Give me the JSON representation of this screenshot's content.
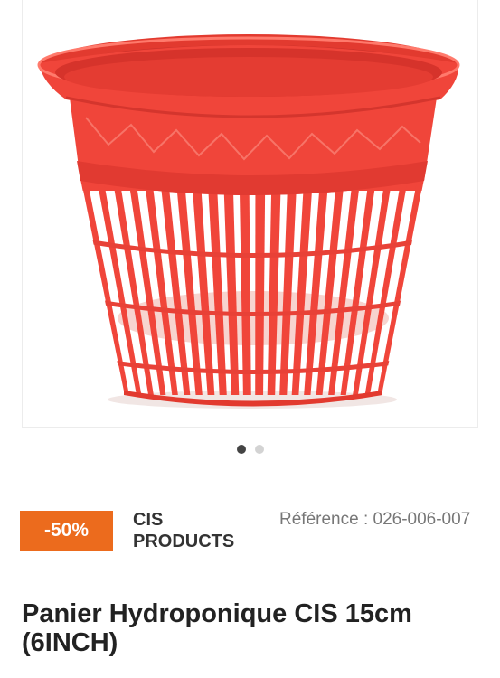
{
  "product": {
    "image_subject": "red-net-pot-basket-icon",
    "accent_color": "#ec6b1d",
    "basket_color": "#f0453a",
    "gallery": {
      "slide_count": 2,
      "active_slide": 1
    },
    "discount_badge": "-50%",
    "brand": "CIS PRODUCTS",
    "reference": "Référence : 026-006-007",
    "title": "Panier Hydroponique CIS 15cm (6INCH)"
  }
}
